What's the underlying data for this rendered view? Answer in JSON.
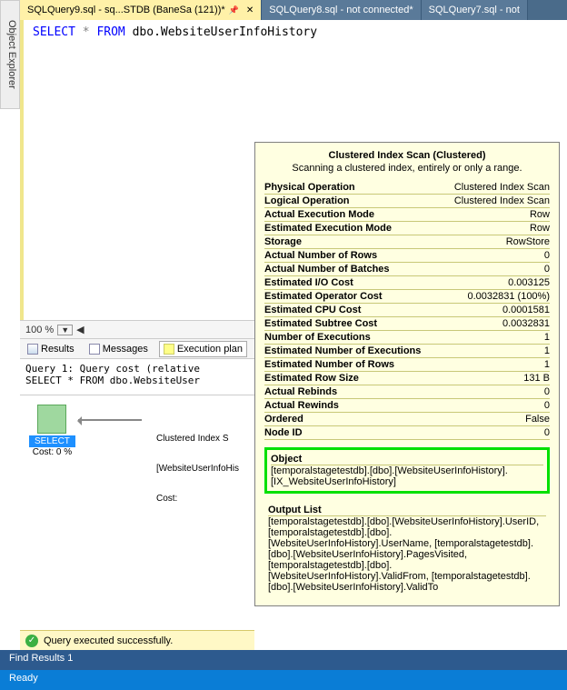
{
  "sidebar": {
    "label": "Object Explorer"
  },
  "tabs": [
    {
      "label": "SQLQuery9.sql - sq...STDB (BaneSa (121))*",
      "active": true
    },
    {
      "label": "SQLQuery8.sql - not connected*",
      "active": false
    },
    {
      "label": "SQLQuery7.sql - not",
      "active": false
    }
  ],
  "sql": {
    "kw1": "SELECT",
    "star": "*",
    "kw2": "FROM",
    "obj": "dbo.WebsiteUserInfoHistory"
  },
  "zoom": {
    "value": "100 %"
  },
  "results_tabs": {
    "results": "Results",
    "messages": "Messages",
    "execplan": "Execution plan"
  },
  "query_header": "Query 1: Query cost (relative\nSELECT * FROM dbo.WebsiteUser",
  "plan": {
    "select": "SELECT",
    "select_cost": "Cost: 0 %",
    "node_title": "Clustered Index S",
    "node_obj": "[WebsiteUserInfoHis",
    "node_cost": "Cost: "
  },
  "status_success": "Query executed successfully.",
  "find_results": "Find Results 1",
  "status_bar": "Ready",
  "tooltip": {
    "title": "Clustered Index Scan (Clustered)",
    "subtitle": "Scanning a clustered index, entirely or only a range.",
    "rows": [
      {
        "k": "Physical Operation",
        "v": "Clustered Index Scan"
      },
      {
        "k": "Logical Operation",
        "v": "Clustered Index Scan"
      },
      {
        "k": "Actual Execution Mode",
        "v": "Row"
      },
      {
        "k": "Estimated Execution Mode",
        "v": "Row"
      },
      {
        "k": "Storage",
        "v": "RowStore"
      },
      {
        "k": "Actual Number of Rows",
        "v": "0"
      },
      {
        "k": "Actual Number of Batches",
        "v": "0"
      },
      {
        "k": "Estimated I/O Cost",
        "v": "0.003125"
      },
      {
        "k": "Estimated Operator Cost",
        "v": "0.0032831 (100%)"
      },
      {
        "k": "Estimated CPU Cost",
        "v": "0.0001581"
      },
      {
        "k": "Estimated Subtree Cost",
        "v": "0.0032831"
      },
      {
        "k": "Number of Executions",
        "v": "1"
      },
      {
        "k": "Estimated Number of Executions",
        "v": "1"
      },
      {
        "k": "Estimated Number of Rows",
        "v": "1"
      },
      {
        "k": "Estimated Row Size",
        "v": "131 B"
      },
      {
        "k": "Actual Rebinds",
        "v": "0"
      },
      {
        "k": "Actual Rewinds",
        "v": "0"
      },
      {
        "k": "Ordered",
        "v": "False"
      },
      {
        "k": "Node ID",
        "v": "0"
      }
    ],
    "object_title": "Object",
    "object_body": "[temporalstagetestdb].[dbo].[WebsiteUserInfoHistory].[IX_WebsiteUserInfoHistory]",
    "output_title": "Output List",
    "output_body": "[temporalstagetestdb].[dbo].[WebsiteUserInfoHistory].UserID, [temporalstagetestdb].[dbo].[WebsiteUserInfoHistory].UserName, [temporalstagetestdb].[dbo].[WebsiteUserInfoHistory].PagesVisited, [temporalstagetestdb].[dbo].[WebsiteUserInfoHistory].ValidFrom, [temporalstagetestdb].[dbo].[WebsiteUserInfoHistory].ValidTo"
  }
}
